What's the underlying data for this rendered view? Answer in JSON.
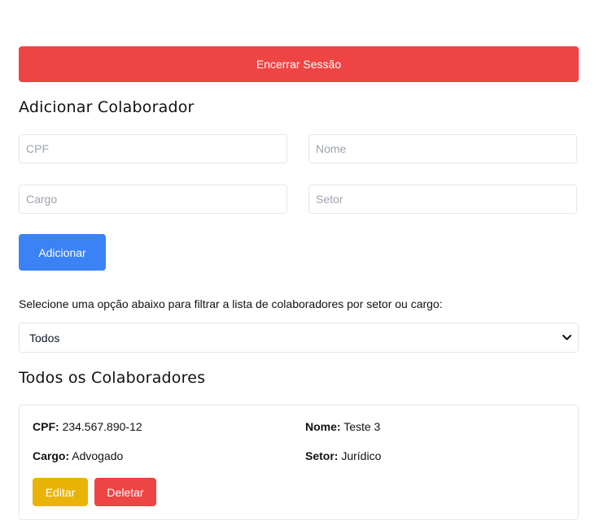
{
  "header": {
    "logout_label": "Encerrar Sessão"
  },
  "add_form": {
    "title": "Adicionar Colaborador",
    "cpf_placeholder": "CPF",
    "cpf_value": "",
    "nome_placeholder": "Nome",
    "nome_value": "",
    "cargo_placeholder": "Cargo",
    "cargo_value": "",
    "setor_placeholder": "Setor",
    "setor_value": "",
    "submit_label": "Adicionar"
  },
  "filter": {
    "label": "Selecione uma opção abaixo para filtrar a lista de colaboradores por setor ou cargo:",
    "selected": "Todos"
  },
  "list": {
    "title": "Todos os Colaboradores",
    "items": [
      {
        "cpf_label": "CPF:",
        "cpf": "234.567.890-12",
        "nome_label": "Nome:",
        "nome": "Teste 3",
        "cargo_label": "Cargo:",
        "cargo": "Advogado",
        "setor_label": "Setor:",
        "setor": "Jurídico",
        "edit_label": "Editar",
        "delete_label": "Deletar"
      }
    ]
  },
  "colors": {
    "danger": "#ef4444",
    "primary": "#3b82f6",
    "warning": "#eab308",
    "border": "#e5e7eb"
  },
  "icons": {
    "select_arrow": "chevron-down-icon"
  }
}
